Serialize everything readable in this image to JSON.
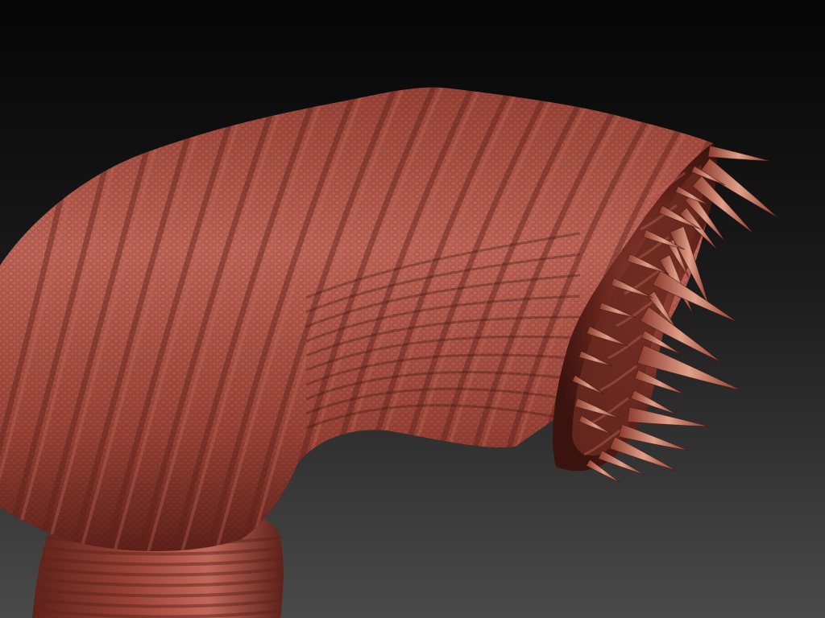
{
  "scene": {
    "subject": "sculpted-worm-creature-render",
    "palette": {
      "background_top": "#050505",
      "background_bottom": "#4a4a4a",
      "clay_highlight": "#c2685a",
      "clay_mid": "#9a4437",
      "clay_shadow": "#5e211a",
      "clay_deep": "#3a130f",
      "tooth_light": "#e0a08a",
      "tooth_dark": "#8e3b2c"
    }
  }
}
